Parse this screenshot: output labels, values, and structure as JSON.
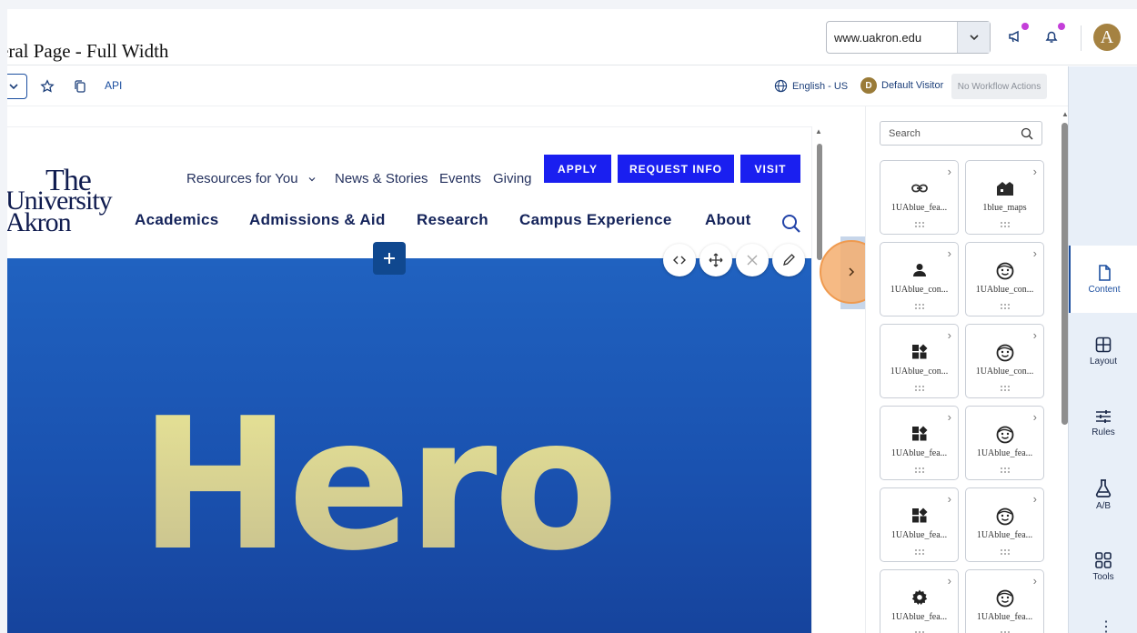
{
  "header": {
    "page_title": "eral Page - Full Width",
    "site_select_value": "www.uakron.edu",
    "avatar_initial": "A"
  },
  "toolbar": {
    "api_label": "API",
    "language": "English - US",
    "visitor_badge": "D",
    "visitor": "Default Visitor",
    "workflow": "No Workflow Actions"
  },
  "site": {
    "logo": {
      "line1": "The",
      "line2": "University",
      "line3": "Akron"
    },
    "utility_nav": [
      "Resources for You",
      "News & Stories",
      "Events",
      "Giving"
    ],
    "cta": [
      "APPLY",
      "REQUEST INFO",
      "VISIT"
    ],
    "main_nav": [
      "Academics",
      "Admissions & Aid",
      "Research",
      "Campus Experience",
      "About"
    ],
    "hero_text": "Hero"
  },
  "panel": {
    "search_placeholder": "Search",
    "components": [
      {
        "label": "1UAblue_fea...",
        "icon": "link-icon"
      },
      {
        "label": "1blue_maps",
        "icon": "map-icon"
      },
      {
        "label": "1UAblue_con...",
        "icon": "person-icon"
      },
      {
        "label": "1UAblue_con...",
        "icon": "face-icon"
      },
      {
        "label": "1UAblue_con...",
        "icon": "widgets-icon"
      },
      {
        "label": "1UAblue_con...",
        "icon": "face-icon"
      },
      {
        "label": "1UAblue_fea...",
        "icon": "widgets-icon"
      },
      {
        "label": "1UAblue_fea...",
        "icon": "face-icon"
      },
      {
        "label": "1UAblue_fea...",
        "icon": "widgets-icon"
      },
      {
        "label": "1UAblue_fea...",
        "icon": "face-icon"
      },
      {
        "label": "1UAblue_fea...",
        "icon": "gear-icon"
      },
      {
        "label": "1UAblue_fea...",
        "icon": "face-icon"
      }
    ]
  },
  "rail": {
    "items": [
      {
        "label": "Content",
        "icon": "document-icon"
      },
      {
        "label": "Layout",
        "icon": "layout-icon"
      },
      {
        "label": "Rules",
        "icon": "sliders-icon"
      },
      {
        "label": "A/B",
        "icon": "flask-icon"
      },
      {
        "label": "Tools",
        "icon": "grid-icon"
      }
    ],
    "more": "⋮"
  },
  "colors": {
    "brand_navy": "#14235a",
    "cta_blue": "#1a1ff0",
    "hero_blue": "#1a52b0",
    "hero_text": "#dcd78f",
    "accent_orange": "#f4ae6e",
    "notification_dot": "#c43fd9"
  }
}
